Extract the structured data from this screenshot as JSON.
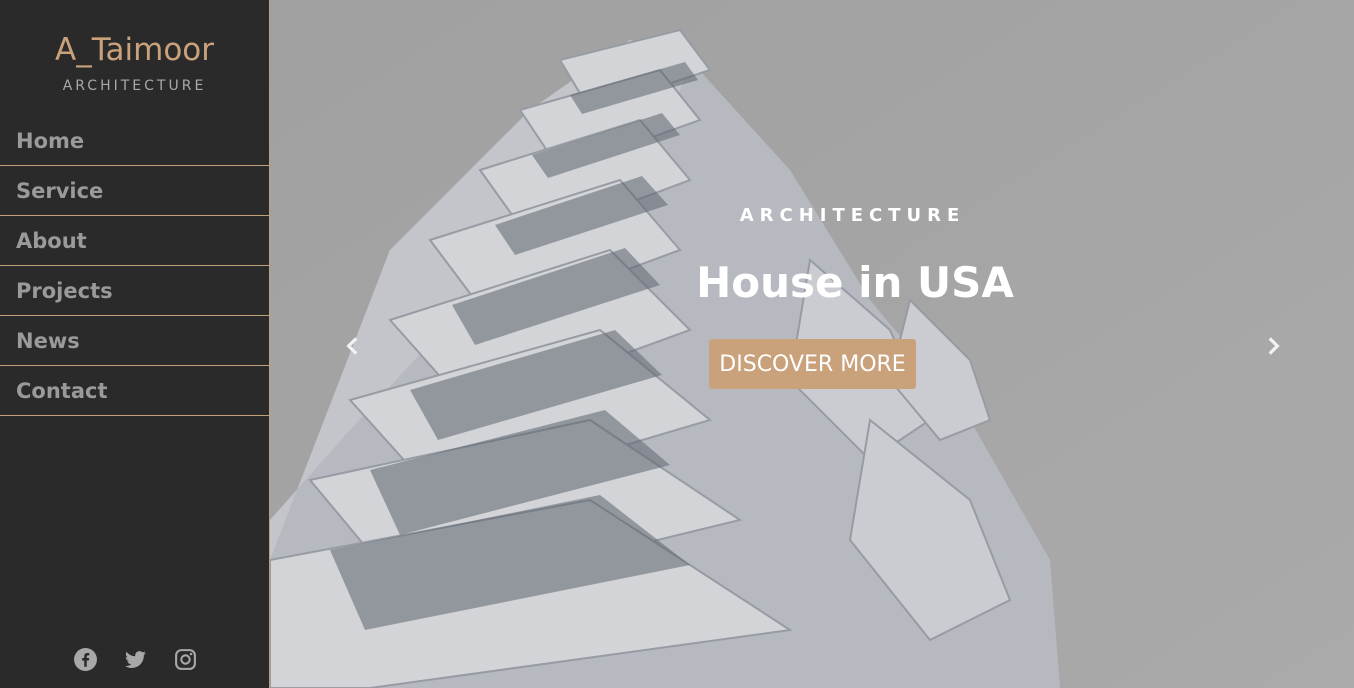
{
  "brand": {
    "title": "A_Taimoor",
    "subtitle": "ARCHITECTURE"
  },
  "nav": {
    "items": [
      {
        "label": "Home"
      },
      {
        "label": "Service"
      },
      {
        "label": "About"
      },
      {
        "label": "Projects"
      },
      {
        "label": "News"
      },
      {
        "label": "Contact"
      }
    ]
  },
  "social": {
    "icons": [
      "facebook-icon",
      "twitter-icon",
      "instagram-icon"
    ]
  },
  "hero": {
    "kicker": "ARCHITECTURE",
    "title": "House in USA",
    "button_label": "DISCOVER MORE",
    "prev_icon": "chevron-left-icon",
    "next_icon": "chevron-right-icon"
  },
  "colors": {
    "sidebar_bg": "#2a2a2a",
    "accent": "#c9a27b",
    "nav_text": "#9a9a9a",
    "hero_bg": "#b3b3b3"
  }
}
